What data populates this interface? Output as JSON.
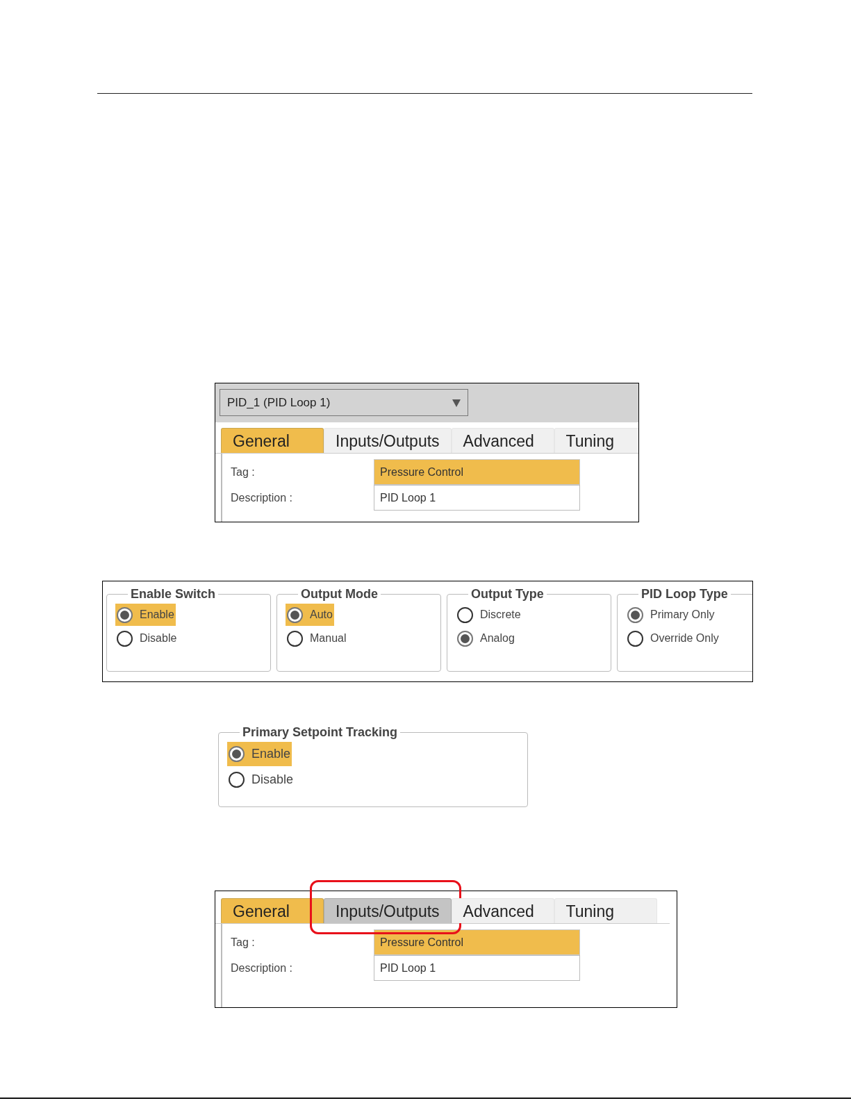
{
  "panels": [
    {
      "kind": "tabs",
      "dropdown": {
        "value": "PID_1 (PID Loop 1)"
      },
      "tabs": [
        {
          "label": "General",
          "selected": true,
          "hovered": false,
          "circled": false
        },
        {
          "label": "Inputs/Outputs",
          "selected": false,
          "hovered": false,
          "circled": false
        },
        {
          "label": "Advanced",
          "selected": false,
          "hovered": false,
          "circled": false
        },
        {
          "label": "Tuning",
          "selected": false,
          "hovered": false,
          "circled": false
        }
      ],
      "fields": [
        {
          "label": "Tag :",
          "value": "Pressure Control",
          "focused": true
        },
        {
          "label": "Description :",
          "value": "PID Loop 1",
          "focused": false
        }
      ]
    },
    {
      "kind": "groups",
      "bordered": true,
      "groups": [
        {
          "title": "Enable Switch",
          "options": [
            {
              "label": "Enable",
              "selected": true,
              "highlighted": true
            },
            {
              "label": "Disable",
              "selected": false,
              "highlighted": false
            }
          ]
        },
        {
          "title": "Output Mode",
          "options": [
            {
              "label": "Auto",
              "selected": true,
              "highlighted": true
            },
            {
              "label": "Manual",
              "selected": false,
              "highlighted": false
            }
          ]
        },
        {
          "title": "Output Type",
          "options": [
            {
              "label": "Discrete",
              "selected": false,
              "highlighted": false
            },
            {
              "label": "Analog",
              "selected": true,
              "highlighted": false
            }
          ]
        },
        {
          "title": "PID Loop Type",
          "options": [
            {
              "label": "Primary Only",
              "selected": true,
              "highlighted": false
            },
            {
              "label": "Override Only",
              "selected": false,
              "highlighted": false
            }
          ]
        }
      ]
    },
    {
      "kind": "groups",
      "bordered": false,
      "groups": [
        {
          "title": "Primary Setpoint Tracking",
          "options": [
            {
              "label": "Enable",
              "selected": true,
              "highlighted": true
            },
            {
              "label": "Disable",
              "selected": false,
              "highlighted": false
            }
          ]
        }
      ]
    },
    {
      "kind": "tabs",
      "tabs": [
        {
          "label": "General",
          "selected": true,
          "hovered": false,
          "circled": false
        },
        {
          "label": "Inputs/Outputs",
          "selected": false,
          "hovered": true,
          "circled": true
        },
        {
          "label": "Advanced",
          "selected": false,
          "hovered": false,
          "circled": false
        },
        {
          "label": "Tuning",
          "selected": false,
          "hovered": false,
          "circled": false
        }
      ],
      "fields": [
        {
          "label": "Tag :",
          "value": "Pressure Control",
          "focused": true
        },
        {
          "label": "Description :",
          "value": "PID Loop 1",
          "focused": false
        }
      ]
    }
  ]
}
